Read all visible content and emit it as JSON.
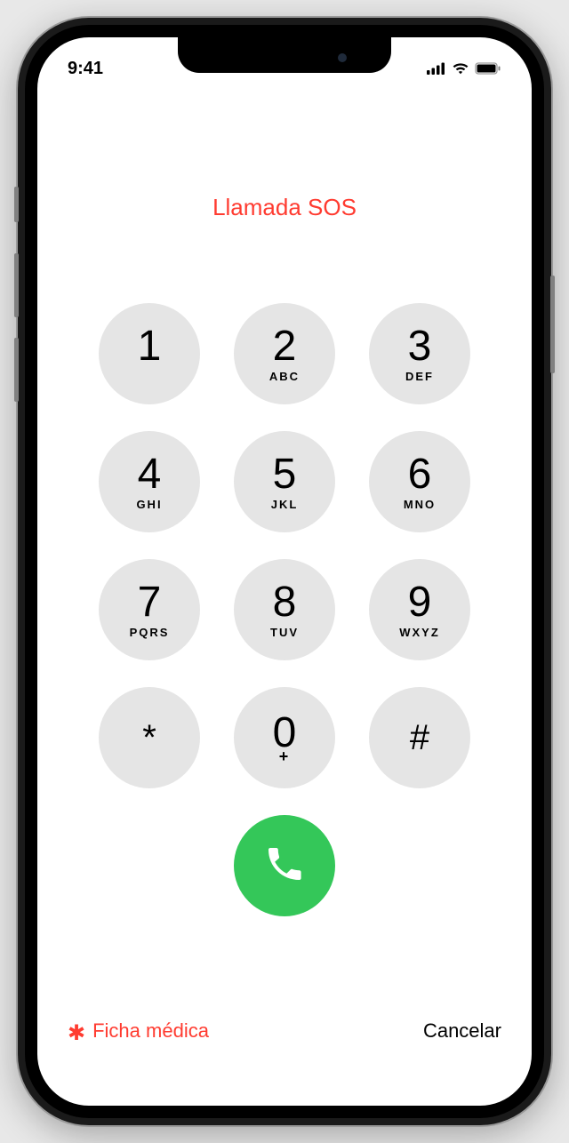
{
  "status": {
    "time": "9:41"
  },
  "title": "Llamada SOS",
  "keypad": [
    {
      "digit": "1",
      "letters": ""
    },
    {
      "digit": "2",
      "letters": "ABC"
    },
    {
      "digit": "3",
      "letters": "DEF"
    },
    {
      "digit": "4",
      "letters": "GHI"
    },
    {
      "digit": "5",
      "letters": "JKL"
    },
    {
      "digit": "6",
      "letters": "MNO"
    },
    {
      "digit": "7",
      "letters": "PQRS"
    },
    {
      "digit": "8",
      "letters": "TUV"
    },
    {
      "digit": "9",
      "letters": "WXYZ"
    },
    {
      "digit": "*",
      "letters": ""
    },
    {
      "digit": "0",
      "letters": "+"
    },
    {
      "digit": "#",
      "letters": ""
    }
  ],
  "footer": {
    "medical_label": "Ficha médica",
    "cancel_label": "Cancelar"
  },
  "colors": {
    "accent_red": "#ff3b30",
    "call_green": "#34c759",
    "key_bg": "#e5e5e5"
  }
}
